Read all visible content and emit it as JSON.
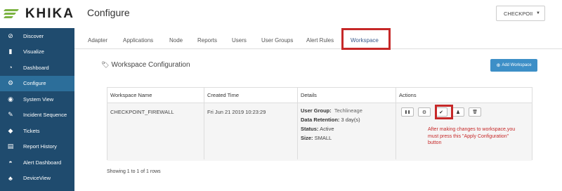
{
  "brand": {
    "name": "KHIKA",
    "logo_color": "#7cb342"
  },
  "sidebar": {
    "bg_color": "#1f4b6e",
    "active_color": "#2c6e9a",
    "items": [
      {
        "label": "Discover",
        "icon": "compass-icon",
        "glyph": "⊘"
      },
      {
        "label": "Visualize",
        "icon": "bar-chart-icon",
        "glyph": "▮"
      },
      {
        "label": "Dashboard",
        "icon": "dashboard-icon",
        "glyph": "◔"
      },
      {
        "label": "Configure",
        "icon": "wrench-icon",
        "glyph": "⚙"
      },
      {
        "label": "System View",
        "icon": "eye-icon",
        "glyph": "◉"
      },
      {
        "label": "Incident Sequence",
        "icon": "incident-icon",
        "glyph": "✎"
      },
      {
        "label": "Tickets",
        "icon": "ticket-icon",
        "glyph": "◆"
      },
      {
        "label": "Report History",
        "icon": "list-icon",
        "glyph": "▤"
      },
      {
        "label": "Alert Dashboard",
        "icon": "gauge-icon",
        "glyph": "◓"
      },
      {
        "label": "DeviceView",
        "icon": "sitemap-icon",
        "glyph": "♣"
      }
    ],
    "active_index": 3
  },
  "header": {
    "title": "Configure",
    "workspace_select": {
      "value": "CHECKPOII",
      "caret": "▼"
    }
  },
  "tabs": [
    {
      "label": "Adapter"
    },
    {
      "label": "Applications"
    },
    {
      "label": "Node"
    },
    {
      "label": "Reports"
    },
    {
      "label": "Users"
    },
    {
      "label": "User Groups"
    },
    {
      "label": "Alert Rules"
    },
    {
      "label": "Workspace",
      "active": true
    }
  ],
  "section": {
    "title": "Workspace Configuration",
    "add_button": "Add Workspace"
  },
  "table": {
    "columns": [
      "Workspace Name",
      "Created Time",
      "Details",
      "Actions"
    ],
    "rows": [
      {
        "name": "CHECKPOINT_FIREWALL",
        "created": "Fri Jun 21 2019 10:23:29",
        "details": {
          "user_group_label": "User Group:",
          "user_group_value": "Techlineage",
          "retention_label": "Data Retention:",
          "retention_value": "3 day(s)",
          "status_label": "Status:",
          "status_value": "Active",
          "size_label": "Size:",
          "size_value": "SMALL"
        },
        "actions": [
          {
            "icon": "pause-icon",
            "glyph": "❚❚"
          },
          {
            "icon": "settings-icon",
            "glyph": "⚙"
          },
          {
            "icon": "apply-check-icon",
            "glyph": "✔"
          },
          {
            "icon": "user-icon",
            "glyph": "♟"
          },
          {
            "icon": "delete-icon",
            "glyph": "🗑"
          }
        ]
      }
    ]
  },
  "annotation": {
    "note": "After making changes to workspace,you must press this \"Apply Configuration\" button",
    "color": "#c62828"
  },
  "footer": {
    "rows_info": "Showing 1 to 1 of 1 rows"
  }
}
